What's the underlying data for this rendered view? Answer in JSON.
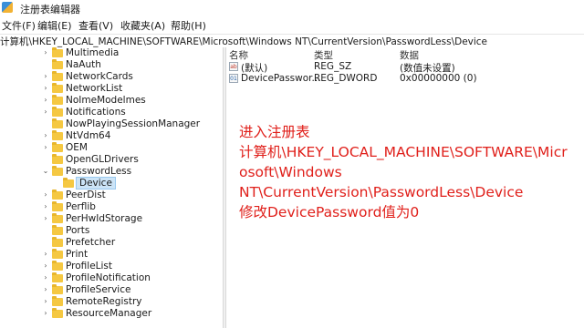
{
  "window": {
    "title": "注册表编辑器"
  },
  "menu": [
    "文件(F)",
    "编辑(E)",
    "查看(V)",
    "收藏夹(A)",
    "帮助(H)"
  ],
  "address": "计算机\\HKEY_LOCAL_MACHINE\\SOFTWARE\\Microsoft\\Windows NT\\CurrentVersion\\PasswordLess\\Device",
  "tree": [
    {
      "label": "Multimedia",
      "expander": "›"
    },
    {
      "label": "NaAuth",
      "expander": ""
    },
    {
      "label": "NetworkCards",
      "expander": "›"
    },
    {
      "label": "NetworkList",
      "expander": "›"
    },
    {
      "label": "NoImeModelmes",
      "expander": "›"
    },
    {
      "label": "Notifications",
      "expander": "›"
    },
    {
      "label": "NowPlayingSessionManager",
      "expander": ""
    },
    {
      "label": "NtVdm64",
      "expander": "›"
    },
    {
      "label": "OEM",
      "expander": "›"
    },
    {
      "label": "OpenGLDrivers",
      "expander": ""
    },
    {
      "label": "PasswordLess",
      "expander": "⌄"
    },
    {
      "label": "Device",
      "expander": "",
      "selected": true
    },
    {
      "label": "PeerDist",
      "expander": "›"
    },
    {
      "label": "Perflib",
      "expander": "›"
    },
    {
      "label": "PerHwIdStorage",
      "expander": "›"
    },
    {
      "label": "Ports",
      "expander": ""
    },
    {
      "label": "Prefetcher",
      "expander": ""
    },
    {
      "label": "Print",
      "expander": "›"
    },
    {
      "label": "ProfileList",
      "expander": "›"
    },
    {
      "label": "ProfileNotification",
      "expander": "›"
    },
    {
      "label": "ProfileService",
      "expander": "›"
    },
    {
      "label": "RemoteRegistry",
      "expander": "›"
    },
    {
      "label": "ResourceManager",
      "expander": "›"
    }
  ],
  "columns": {
    "name": "名称",
    "type": "类型",
    "data": "数据"
  },
  "values": [
    {
      "icon": "string-value-icon",
      "name": "(默认)",
      "type": "REG_SZ",
      "data": "(数值未设置)"
    },
    {
      "icon": "dword-value-icon",
      "name": "DevicePasswor...",
      "type": "REG_DWORD",
      "data": "0x00000000 (0)"
    }
  ],
  "annotation": {
    "line1": "进入注册表",
    "line2": "计算机\\HKEY_LOCAL_MACHINE\\SOFTWARE\\Micr",
    "line3": "osoft\\Windows",
    "line4": "NT\\CurrentVersion\\PasswordLess\\Device",
    "line5": "修改DevicePassword值为0",
    "color": "#e0201b"
  }
}
